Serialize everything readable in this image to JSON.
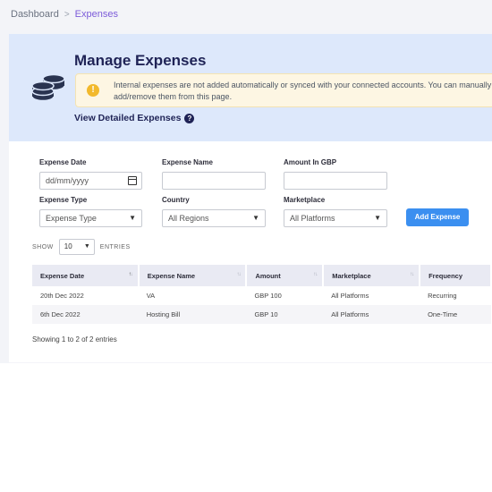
{
  "breadcrumb": {
    "parent": "Dashboard",
    "separator": ">",
    "current": "Expenses"
  },
  "header": {
    "title": "Manage Expenses",
    "notice": "Internal expenses are not added automatically or synced with your connected accounts. You can manually add/remove them from this page.",
    "notice_icon": "!",
    "detail_link": "View Detailed Expenses",
    "help_icon": "?"
  },
  "form": {
    "expense_date": {
      "label": "Expense Date",
      "placeholder": "dd/mm/yyyy"
    },
    "expense_name": {
      "label": "Expense Name",
      "value": ""
    },
    "amount": {
      "label": "Amount In GBP",
      "value": ""
    },
    "expense_type": {
      "label": "Expense Type",
      "selected": "Expense Type"
    },
    "country": {
      "label": "Country",
      "selected": "All Regions"
    },
    "marketplace": {
      "label": "Marketplace",
      "selected": "All Platforms"
    },
    "add_button": "Add Expense"
  },
  "table_controls": {
    "show_label": "SHOW",
    "show_value": "10",
    "entries_label": "ENTRIES"
  },
  "table": {
    "columns": [
      "Expense Date",
      "Expense Name",
      "Amount",
      "Marketplace",
      "Frequency"
    ],
    "rows": [
      [
        "20th Dec 2022",
        "VA",
        "GBP 100",
        "All Platforms",
        "Recurring"
      ],
      [
        "6th Dec 2022",
        "Hosting Bill",
        "GBP 10",
        "All Platforms",
        "One-Time"
      ]
    ],
    "info": "Showing 1 to 2 of 2 entries"
  },
  "colors": {
    "accent": "#3b8ff0",
    "title": "#1f2356",
    "breadcrumb_active": "#7c5bd9",
    "header_bg": "#dde8fb"
  }
}
